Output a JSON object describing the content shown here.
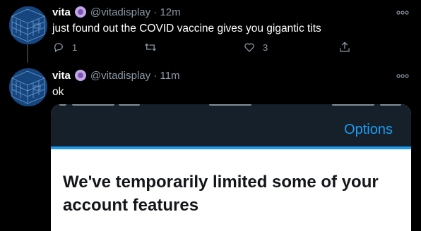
{
  "tweets": [
    {
      "name": "vita",
      "handle": "@vitadisplay",
      "separator": "·",
      "time": "12m",
      "text": "just found out the COVID vaccine gives you gigantic tits",
      "actions": {
        "reply_count": "1",
        "retweet_count": "",
        "like_count": "3"
      }
    },
    {
      "name": "vita",
      "handle": "@vitadisplay",
      "separator": "·",
      "time": "11m",
      "text": "ok"
    }
  ],
  "embedded_screenshot": {
    "options_label": "Options",
    "title": "We've temporarily limited some of your account features"
  },
  "icons": {
    "avatar": "avatar-image",
    "badge": "purple-orb-emoji",
    "more": "more-dots-icon",
    "reply": "reply-icon",
    "retweet": "retweet-icon",
    "like": "heart-icon",
    "share": "share-icon"
  },
  "colors": {
    "background": "#000000",
    "secondary_text": "#8b98a5",
    "accent": "#1d9bf0",
    "embedded_header": "#15202b"
  }
}
